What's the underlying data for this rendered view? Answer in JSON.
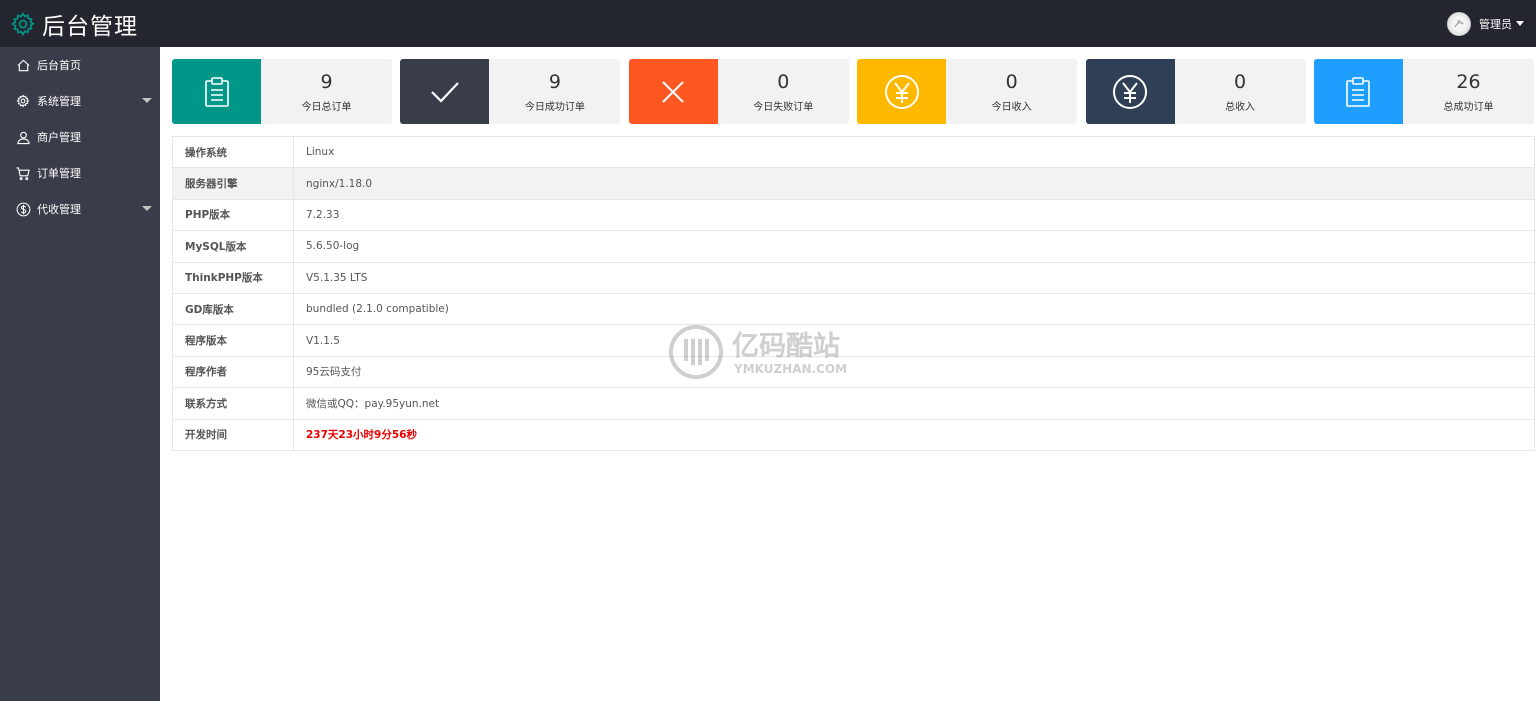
{
  "header": {
    "app_title": "后台管理",
    "user_name": "管理员",
    "icons": {
      "logo": "gear-icon",
      "avatar": "avatar-image",
      "caret": "caret-down-icon"
    }
  },
  "sidebar": {
    "items": [
      {
        "label": "后台首页",
        "icon": "home-icon",
        "has_submenu": false
      },
      {
        "label": "系统管理",
        "icon": "gear-icon",
        "has_submenu": true
      },
      {
        "label": "商户管理",
        "icon": "user-icon",
        "has_submenu": false
      },
      {
        "label": "订单管理",
        "icon": "cart-icon",
        "has_submenu": false
      },
      {
        "label": "代收管理",
        "icon": "dollar-icon",
        "has_submenu": true
      }
    ]
  },
  "stats": [
    {
      "value": "9",
      "label": "今日总订单",
      "color": "#009688",
      "icon": "clipboard-icon"
    },
    {
      "value": "9",
      "label": "今日成功订单",
      "color": "#393d49",
      "icon": "check-icon"
    },
    {
      "value": "0",
      "label": "今日失败订单",
      "color": "#ff5722",
      "icon": "close-icon"
    },
    {
      "value": "0",
      "label": "今日收入",
      "color": "#ffb800",
      "icon": "yen-circle-icon"
    },
    {
      "value": "0",
      "label": "总收入",
      "color": "#2f4056",
      "icon": "yen-circle-icon"
    },
    {
      "value": "26",
      "label": "总成功订单",
      "color": "#1e9fff",
      "icon": "clipboard-icon"
    }
  ],
  "system_info": [
    {
      "key": "操作系统",
      "value": "Linux"
    },
    {
      "key": "服务器引擎",
      "value": "nginx/1.18.0"
    },
    {
      "key": "PHP版本",
      "value": "7.2.33"
    },
    {
      "key": "MySQL版本",
      "value": "5.6.50-log"
    },
    {
      "key": "ThinkPHP版本",
      "value": "V5.1.35 LTS"
    },
    {
      "key": "GD库版本",
      "value": "bundled (2.1.0 compatible)"
    },
    {
      "key": "程序版本",
      "value": "V1.1.5"
    },
    {
      "key": "程序作者",
      "value": "95云码支付"
    },
    {
      "key": "联系方式",
      "value": "微信或QQ：pay.95yun.net"
    },
    {
      "key": "开发时间",
      "value": "237天23小时9分56秒"
    }
  ],
  "watermark": {
    "title": "亿码酷站",
    "url": "YMKUZHAN.COM"
  },
  "colors": {
    "topbar": "#23262e",
    "sidebar": "#393d49",
    "highlight_red": "#ee0000",
    "logo_gear": "#009688"
  }
}
